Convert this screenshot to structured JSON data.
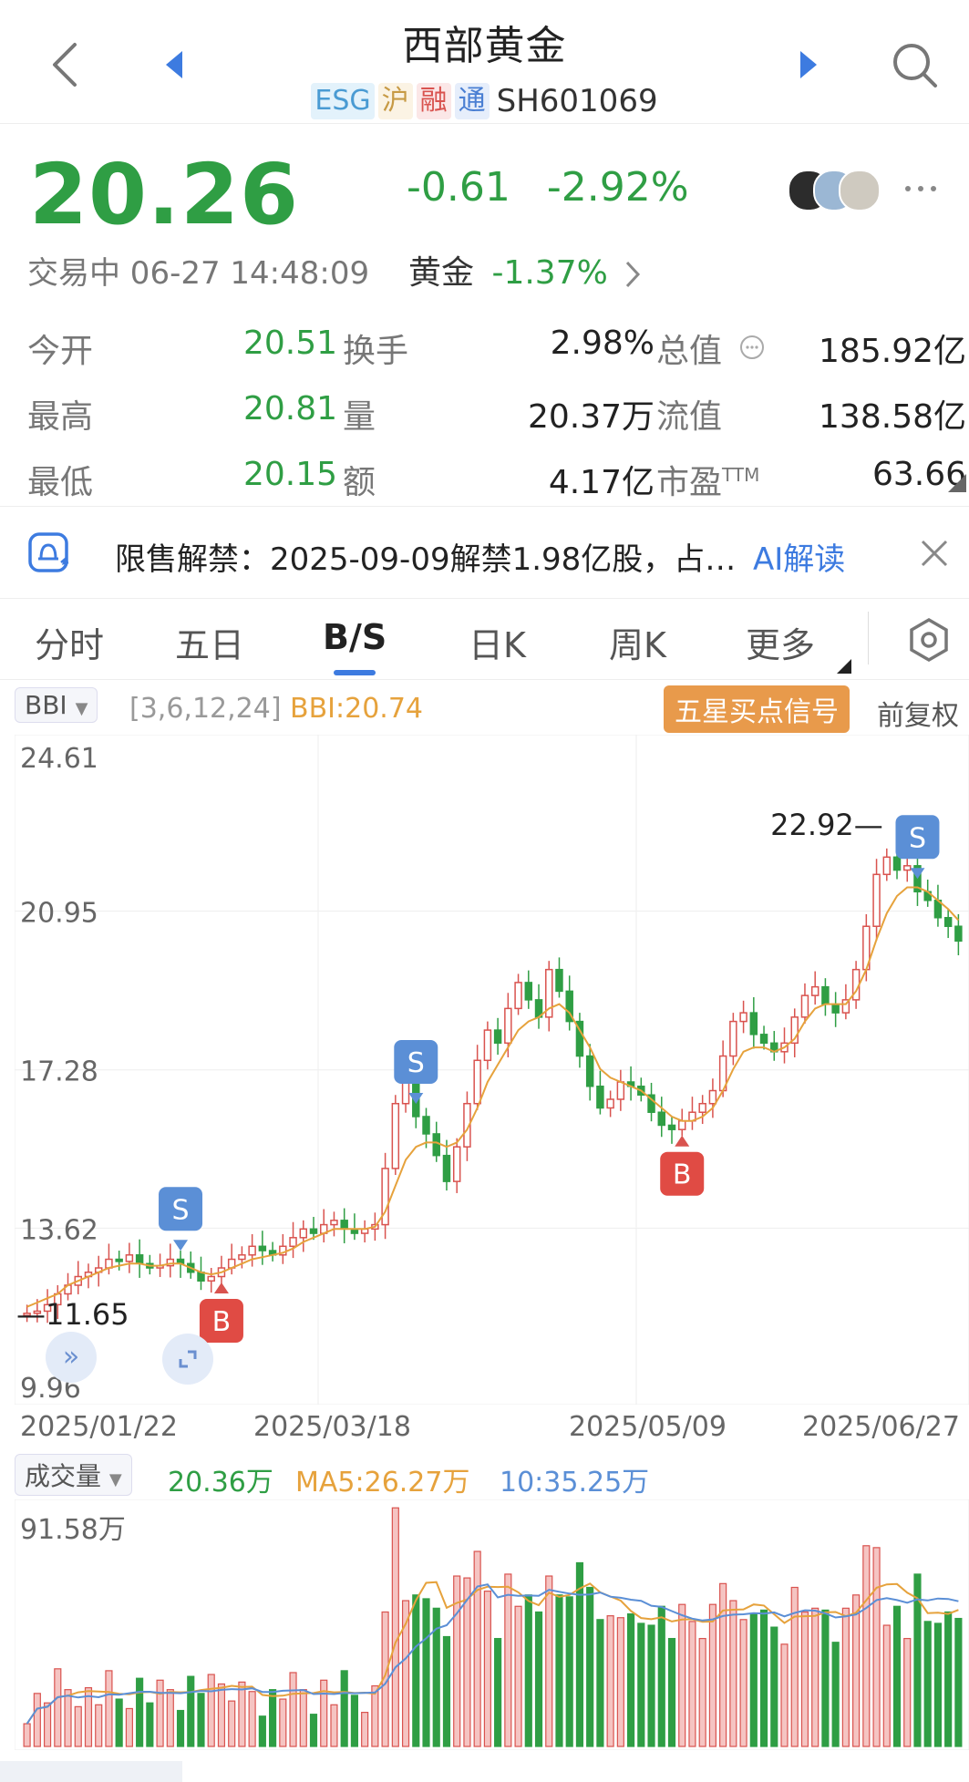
{
  "header": {
    "title": "西部黄金",
    "tags": [
      "ESG",
      "沪",
      "融",
      "通"
    ],
    "code": "SH601069"
  },
  "quote": {
    "price": "20.26",
    "change": "-0.61",
    "change_pct": "-2.92%",
    "status": "交易中 06-27 14:48:09",
    "sector_name": "黄金",
    "sector_change": "-1.37%"
  },
  "stats": {
    "rows": [
      [
        {
          "label": "今开",
          "value": "20.51"
        },
        {
          "label": "换手",
          "value": "2.98%"
        },
        {
          "label": "总值",
          "value": "185.92亿"
        }
      ],
      [
        {
          "label": "最高",
          "value": "20.81"
        },
        {
          "label": "量",
          "value": "20.37万"
        },
        {
          "label": "流值",
          "value": "138.58亿"
        }
      ],
      [
        {
          "label": "最低",
          "value": "20.15"
        },
        {
          "label": "额",
          "value": "4.17亿"
        },
        {
          "label": "市盈",
          "label_sup": "TTM",
          "value": "63.66"
        }
      ]
    ]
  },
  "notice": {
    "text": "限售解禁：2025-09-09解禁1.98亿股，占…",
    "ai_label": "AI解读"
  },
  "tabs": [
    "分时",
    "五日",
    "B/S",
    "日K",
    "周K",
    "更多"
  ],
  "active_tab": "B/S",
  "indicator": {
    "selector": "BBI",
    "params": "[3,6,12,24]",
    "value": "BBI:20.74",
    "signal_button": "五星买点信号",
    "adjust": "前复权"
  },
  "chart_data": {
    "type": "candlestick",
    "y_ticks": [
      "24.61",
      "20.95",
      "17.28",
      "13.62",
      "9.96"
    ],
    "ylim": [
      9.96,
      24.61
    ],
    "x_labels": [
      "2025/01/22",
      "2025/03/18",
      "2025/05/09",
      "2025/06/27"
    ],
    "high_mark": "22.92",
    "low_mark": "11.65",
    "markers": [
      {
        "type": "S",
        "label": "S"
      },
      {
        "type": "B",
        "label": "B"
      },
      {
        "type": "S",
        "label": "S"
      },
      {
        "type": "B",
        "label": "B"
      },
      {
        "type": "S",
        "label": "S"
      }
    ],
    "closes": [
      11.65,
      11.7,
      11.85,
      12.1,
      12.3,
      12.5,
      12.6,
      12.7,
      12.9,
      12.85,
      13.0,
      12.8,
      12.7,
      12.75,
      12.9,
      12.8,
      12.6,
      12.4,
      12.5,
      12.7,
      12.9,
      13.0,
      13.2,
      13.1,
      13.0,
      13.2,
      13.4,
      13.6,
      13.5,
      13.7,
      13.8,
      13.6,
      13.5,
      13.6,
      13.7,
      15.0,
      16.5,
      17.0,
      16.2,
      15.8,
      15.3,
      14.7,
      15.5,
      16.5,
      17.5,
      18.2,
      17.9,
      18.7,
      19.3,
      18.9,
      18.5,
      19.6,
      19.1,
      18.4,
      17.6,
      16.9,
      16.4,
      16.6,
      17.0,
      16.9,
      16.7,
      16.3,
      16.0,
      15.9,
      16.1,
      16.3,
      16.5,
      16.8,
      17.6,
      18.4,
      18.6,
      18.1,
      17.9,
      17.7,
      17.9,
      18.5,
      19.0,
      19.2,
      18.8,
      18.6,
      18.9,
      19.6,
      20.6,
      21.8,
      22.2,
      21.9,
      22.0,
      21.4,
      21.2,
      20.8,
      20.6,
      20.26
    ],
    "bbi": [
      11.8,
      11.9,
      12.0,
      12.1,
      12.3,
      12.4,
      12.5,
      12.6,
      12.7,
      12.75,
      12.8,
      12.8,
      12.75,
      12.75,
      12.8,
      12.8,
      12.7,
      12.6,
      12.55,
      12.6,
      12.7,
      12.8,
      12.9,
      12.95,
      13.0,
      13.05,
      13.15,
      13.3,
      13.4,
      13.5,
      13.6,
      13.6,
      13.6,
      13.6,
      13.65,
      14.0,
      14.6,
      15.2,
      15.5,
      15.6,
      15.6,
      15.5,
      15.6,
      15.9,
      16.4,
      17.0,
      17.4,
      17.8,
      18.2,
      18.4,
      18.5,
      18.7,
      18.8,
      18.6,
      18.2,
      17.8,
      17.3,
      17.1,
      17.0,
      16.9,
      16.8,
      16.6,
      16.4,
      16.2,
      16.1,
      16.1,
      16.2,
      16.4,
      16.8,
      17.3,
      17.7,
      17.8,
      17.8,
      17.7,
      17.8,
      18.0,
      18.4,
      18.7,
      18.8,
      18.8,
      18.8,
      19.1,
      19.6,
      20.3,
      20.9,
      21.3,
      21.5,
      21.5,
      21.4,
      21.2,
      21.0,
      20.74
    ]
  },
  "volume": {
    "selector": "成交量",
    "value": "20.36万",
    "ma5": "MA5:26.27万",
    "ma10": "10:35.25万",
    "y_tick": "91.58万"
  }
}
